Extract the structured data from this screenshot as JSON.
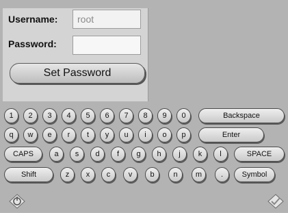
{
  "form": {
    "username_label": "Username:",
    "username_value": "root",
    "password_label": "Password:",
    "password_value": "",
    "set_button": "Set Password"
  },
  "keyboard": {
    "row1": [
      "1",
      "2",
      "3",
      "4",
      "5",
      "6",
      "7",
      "8",
      "9",
      "0",
      "Backspace"
    ],
    "row2": [
      "q",
      "w",
      "e",
      "r",
      "t",
      "y",
      "u",
      "i",
      "o",
      "p",
      "Enter"
    ],
    "row3": [
      "CAPS",
      "a",
      "s",
      "d",
      "f",
      "g",
      "h",
      "j",
      "k",
      "l",
      "SPACE"
    ],
    "row4": [
      "Shift",
      "z",
      "x",
      "c",
      "v",
      "b",
      "n",
      "m",
      ".",
      "Symbol"
    ]
  },
  "icons": {
    "bottom_left": "power-icon",
    "bottom_right": "checkmark-icon"
  }
}
